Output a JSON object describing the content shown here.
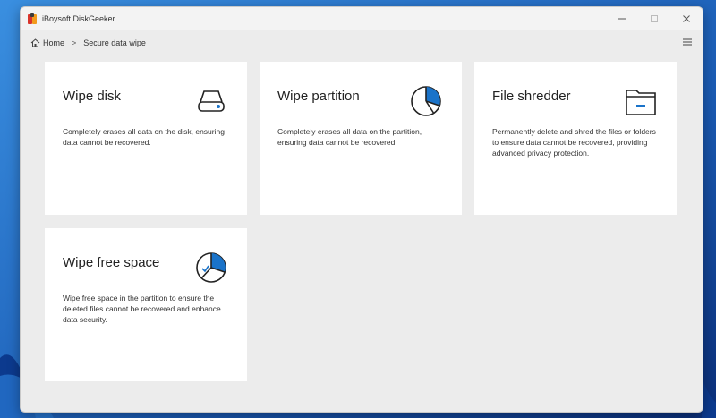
{
  "window": {
    "title": "iBoysoft DiskGeeker"
  },
  "breadcrumb": {
    "home_label": "Home",
    "separator": ">",
    "current": "Secure data wipe"
  },
  "cards": [
    {
      "title": "Wipe disk",
      "description": "Completely erases all data on the disk, ensuring data cannot be recovered.",
      "icon": "disk-drive-icon"
    },
    {
      "title": "Wipe partition",
      "description": "Completely erases all data on the partition, ensuring data cannot be recovered.",
      "icon": "partition-pie-icon"
    },
    {
      "title": "File shredder",
      "description": "Permanently delete and shred the files or folders to ensure data cannot be recovered, providing advanced privacy protection.",
      "icon": "folder-minus-icon"
    },
    {
      "title": "Wipe free space",
      "description": "Wipe free space in the partition to ensure the deleted files cannot be recovered and enhance data security.",
      "icon": "free-space-check-icon"
    }
  ],
  "colors": {
    "accent": "#1a73c9",
    "card_bg": "#ffffff",
    "window_bg": "#ececec"
  }
}
